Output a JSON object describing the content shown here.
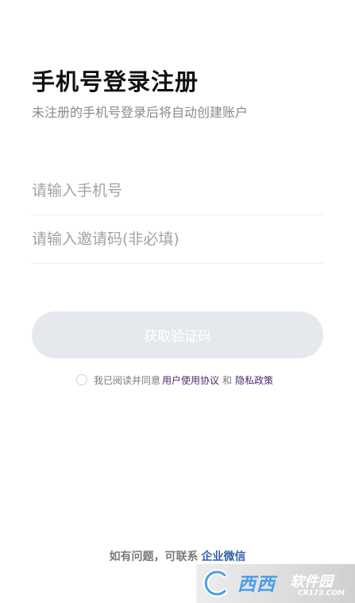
{
  "header": {
    "title": "手机号登录注册",
    "subtitle": "未注册的手机号登录后将自动创建账户"
  },
  "form": {
    "phone_placeholder": "请输入手机号",
    "invite_placeholder": "请输入邀请码(非必填)",
    "submit_label": "获取验证码"
  },
  "agreement": {
    "prefix": "我已阅读并同意",
    "user_agreement": "用户使用协议",
    "joiner": "和",
    "privacy_policy": "隐私政策"
  },
  "footer": {
    "text": "如有问题，可联系",
    "link": "企业微信"
  },
  "watermark": {
    "brand": "西西",
    "suffix": "软件园",
    "domain": "CR173.COM"
  },
  "colors": {
    "button_bg": "#e5e8ed",
    "link_purple": "#4b2a6b",
    "link_blue": "#2f5fa8"
  }
}
